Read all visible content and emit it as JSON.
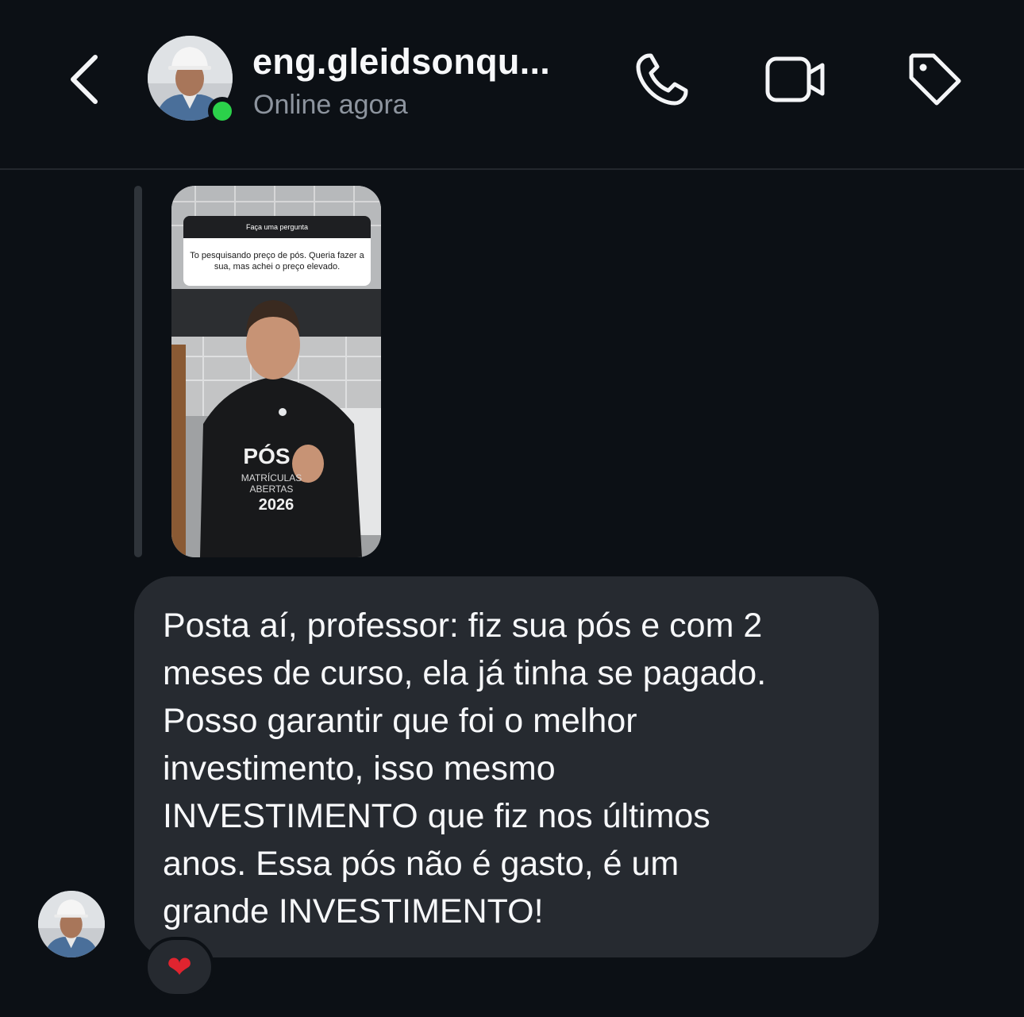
{
  "header": {
    "contact_name": "eng.gleidsonqu...",
    "status": "Online agora"
  },
  "story_reply": {
    "question_title": "Faça uma pergunta",
    "question_text": "To pesquisando preço de pós. Queria fazer a sua, mas achei o preço elevado.",
    "shirt_text_1": "PÓS",
    "shirt_text_2": "MATRÍCULAS",
    "shirt_text_3": "ABERTAS",
    "shirt_text_4": "2026"
  },
  "message": {
    "text": "Posta aí, professor: fiz sua pós e com 2\nmeses de curso, ela já tinha se pagado.\nPosso garantir que foi o melhor\ninvestimento, isso mesmo\nINVESTIMENTO que fiz nos últimos\nanos. Essa pós não é gasto, é um\ngrande INVESTIMENTO!",
    "reaction": "❤"
  },
  "colors": {
    "background": "#0c1015",
    "bubble": "#262a30",
    "online_dot": "#2bd14a",
    "status_text": "#8d949e",
    "reaction_heart": "#e0242f"
  },
  "icons": {
    "back": "chevron-left-icon",
    "call": "phone-icon",
    "video": "video-camera-icon",
    "tag": "tag-icon"
  }
}
